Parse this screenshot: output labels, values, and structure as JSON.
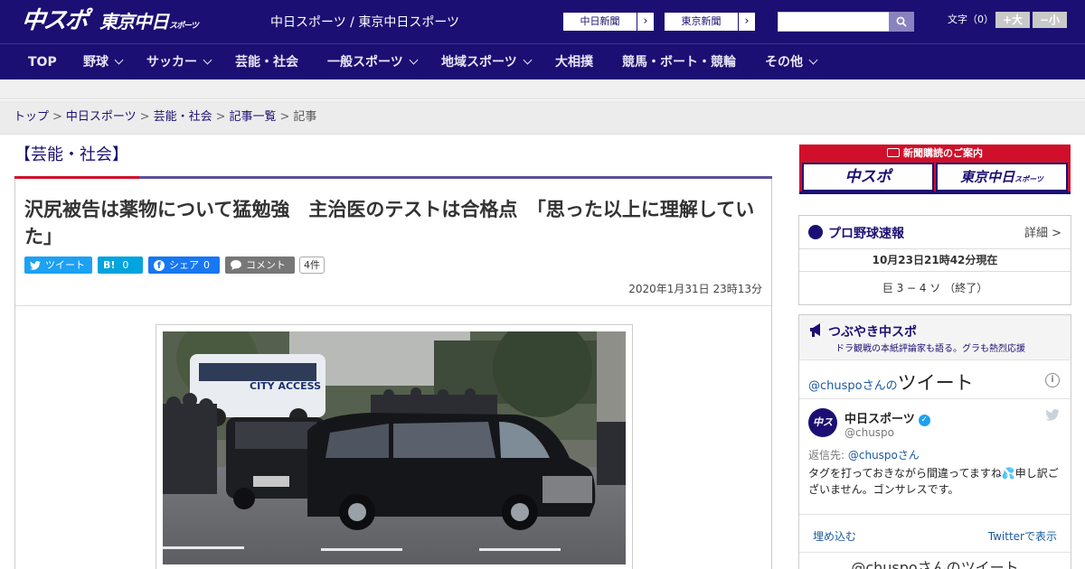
{
  "header": {
    "logo_chuspo": "中スポ",
    "logo_tokyo": "東京中日",
    "logo_tokyo_sub": "スポーツ",
    "tagline": "中日スポーツ / 東京中日スポーツ",
    "paper_links": [
      {
        "label": "中日新聞"
      },
      {
        "label": "東京新聞"
      }
    ],
    "search_placeholder": "",
    "font_size_label": "文字（0）",
    "font_large": "+大",
    "font_small": "−小"
  },
  "nav": {
    "items": [
      {
        "label": "TOP"
      },
      {
        "label": "野球"
      },
      {
        "label": "サッカー"
      },
      {
        "label": "芸能・社会"
      },
      {
        "label": "一般スポーツ"
      },
      {
        "label": "地域スポーツ"
      },
      {
        "label": "大相撲"
      },
      {
        "label": "競馬・ボート・競輪"
      },
      {
        "label": "その他"
      }
    ]
  },
  "breadcrumb": {
    "items": [
      "トップ",
      "中日スポーツ",
      "芸能・社会",
      "記事一覧"
    ],
    "current": "記事"
  },
  "article": {
    "category": "【芸能・社会】",
    "headline": "沢尻被告は薬物について猛勉強　主治医のテストは合格点　「思った以上に理解していた」",
    "share": {
      "tweet": "ツイート",
      "hatena_count": "0",
      "fb_label": "シェア",
      "fb_count": "0",
      "comment": "コメント",
      "comment_count": "4件"
    },
    "date": "2020年1月31日 23時13分",
    "photo_bus_text": "CITY ACCESS"
  },
  "sidebar": {
    "ad_header": "新聞購読のご案内",
    "ad_logos": [
      "中スポ",
      "東京中日"
    ],
    "ad_logo_sub": "スポーツ",
    "baseball": {
      "title": "プロ野球速報",
      "detail": "詳細 >",
      "time": "10月23日21時42分現在",
      "score": "巨 3 − 4 ソ （終了）"
    },
    "tweets": {
      "title": "つぶやき中スポ",
      "subtitle": "ドラ観戦の本紙評論家も語る。グラも熱烈応援",
      "header_handle": "@chuspoさんの",
      "header_big": "ツイート",
      "account_name": "中日スポーツ",
      "account_handle": "@chuspo",
      "avatar_text": "中スポ",
      "reply_prefix": "返信先: ",
      "reply_handle": "@chuspoさん",
      "text": "タグを打っておきながら間違ってますね💦申し訳ございません。ゴンサレスです。",
      "embed": "埋め込む",
      "view_on": "Twitterで表示",
      "more": "@chuspoさんのツイート"
    }
  },
  "colors": {
    "brand_navy": "#1c0f73",
    "accent_red": "#d0102a",
    "twitter_blue": "#1da1f2"
  }
}
